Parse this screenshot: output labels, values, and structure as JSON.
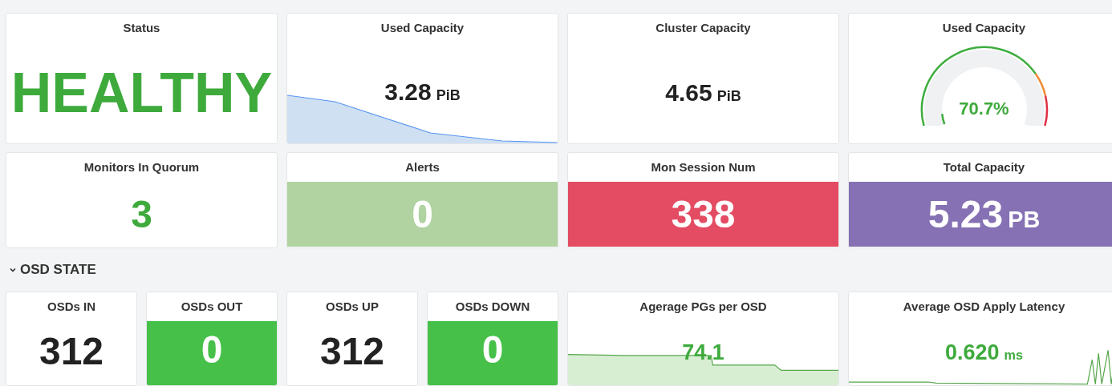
{
  "panels_top": [
    {
      "title": "Status",
      "kind": "headline",
      "color": "#3eaa3c",
      "value": "HEALTHY"
    },
    {
      "title": "Used Capacity",
      "kind": "sparkline",
      "color": "#222222",
      "value": "3.28",
      "unit": "PiB"
    },
    {
      "title": "Cluster Capacity",
      "kind": "stat",
      "color": "#222222",
      "value": "4.65",
      "unit": "PiB"
    },
    {
      "title": "Used Capacity",
      "kind": "gauge",
      "color": "#3eaa3c",
      "value": "70.7%"
    },
    {
      "title": "Monitors In Quorum",
      "kind": "stat",
      "color": "#3eaa3c",
      "value": "3"
    },
    {
      "title": "Alerts",
      "kind": "filled",
      "color": "#b0d3a1",
      "value": "0"
    },
    {
      "title": "Mon Session Num",
      "kind": "filled",
      "color": "#e34c62",
      "value": "338"
    },
    {
      "title": "Total Capacity",
      "kind": "filled",
      "color": "#8571b3",
      "value": "5.23",
      "unit": "PB"
    }
  ],
  "section": {
    "title": "OSD STATE",
    "expanded": true
  },
  "osd_panels": [
    {
      "title": "OSDs IN",
      "kind": "stat",
      "color": "#222222",
      "value": "312"
    },
    {
      "title": "OSDs OUT",
      "kind": "filled",
      "color": "#46c048",
      "value": "0"
    },
    {
      "title": "OSDs UP",
      "kind": "stat",
      "color": "#222222",
      "value": "312"
    },
    {
      "title": "OSDs DOWN",
      "kind": "filled",
      "color": "#46c048",
      "value": "0"
    },
    {
      "title": "Agerage PGs per OSD",
      "kind": "sparkline",
      "color": "#3eaa3c",
      "value": "74.1"
    },
    {
      "title": "Average OSD Apply Latency",
      "kind": "sparkline",
      "color": "#3eaa3c",
      "value": "0.620",
      "unit": "ms"
    }
  ]
}
